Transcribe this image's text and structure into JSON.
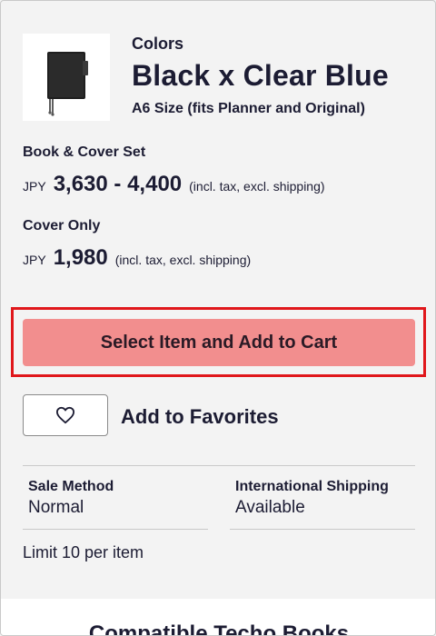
{
  "product": {
    "thumbnail_icon": "notebook-cover-icon",
    "category": "Colors",
    "name": "Black x Clear Blue",
    "size": "A6 Size (fits Planner and Original)"
  },
  "options": [
    {
      "label": "Book & Cover Set",
      "currency": "JPY",
      "price": "3,630 - 4,400",
      "tax_note": "(incl. tax, excl. shipping)"
    },
    {
      "label": "Cover Only",
      "currency": "JPY",
      "price": "1,980",
      "tax_note": "(incl. tax, excl. shipping)"
    }
  ],
  "actions": {
    "add_to_cart_label": "Select Item and Add to Cart",
    "favorite_icon": "heart-icon",
    "favorite_label": "Add to Favorites"
  },
  "info": {
    "sale_method_label": "Sale Method",
    "sale_method_value": "Normal",
    "shipping_label": "International Shipping",
    "shipping_value": "Available",
    "limit": "Limit 10 per item"
  },
  "next_section": {
    "title": "Compatible Techo Books"
  },
  "colors": {
    "cart_button": "#f28e8e",
    "highlight_border": "#e0171b",
    "text": "#1c1c33"
  }
}
